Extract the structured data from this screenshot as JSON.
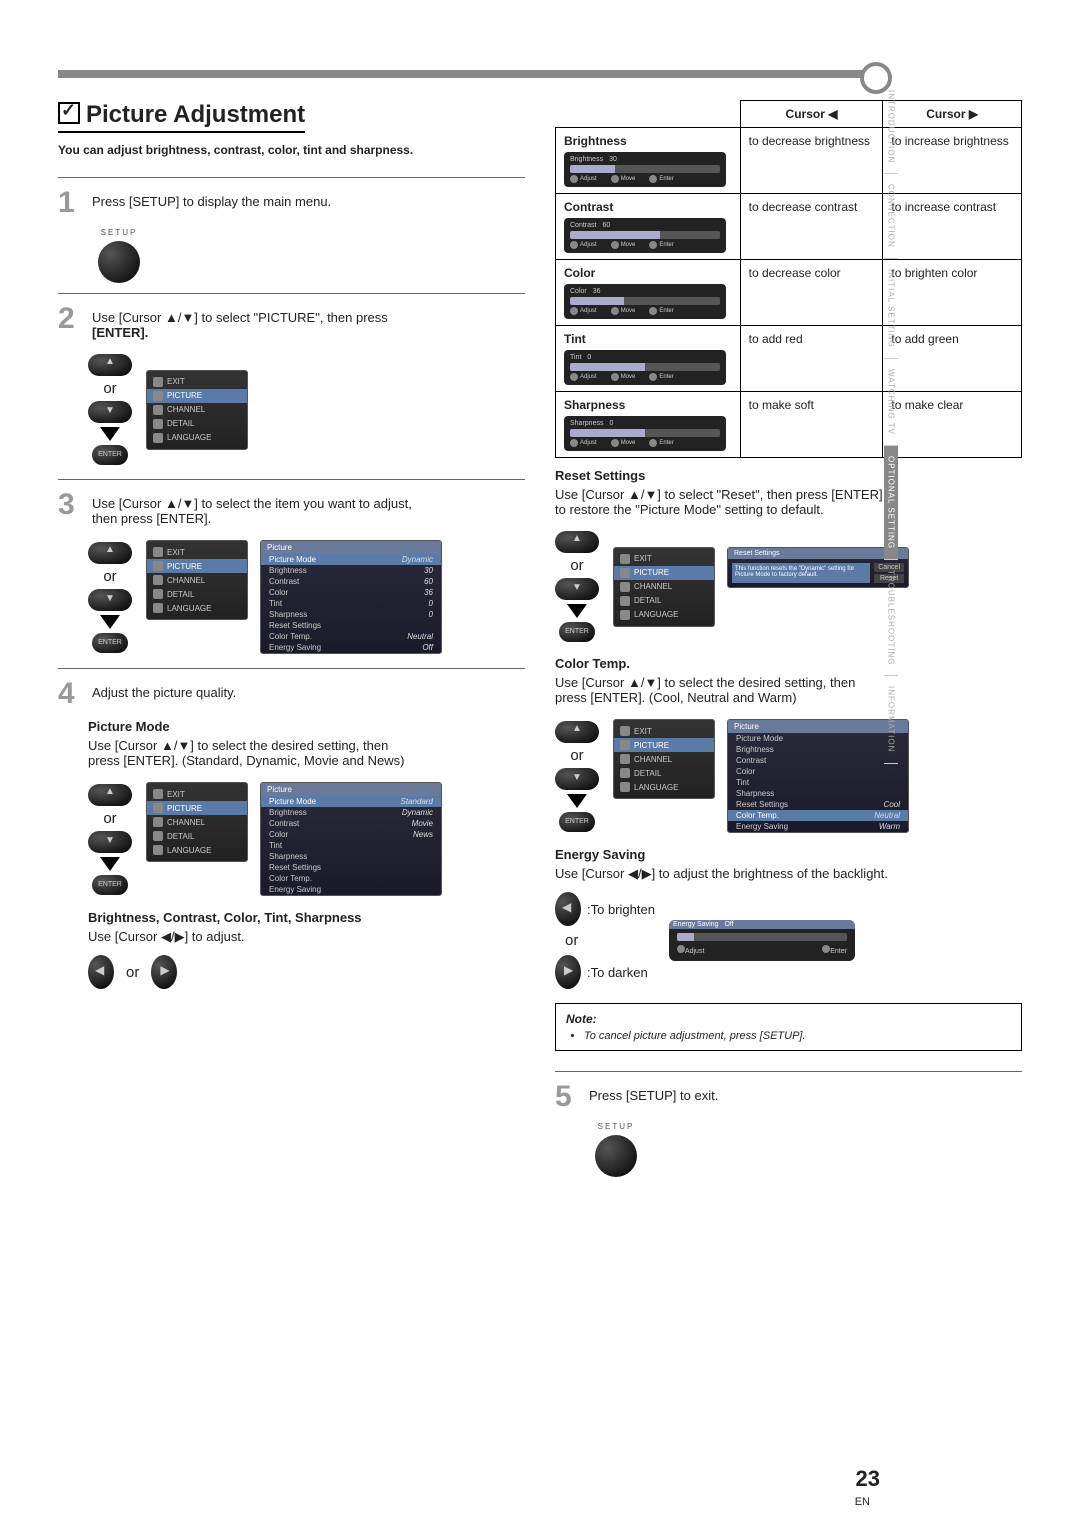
{
  "page_number": "23",
  "page_lang": "EN",
  "title": "Picture Adjustment",
  "intro": "You can adjust brightness, contrast, color, tint and sharpness.",
  "side_tabs": [
    "INTRODUCTION",
    "CONNECTION",
    "INITIAL SETTING",
    "WATCHING TV",
    "OPTIONAL SETTING",
    "TROUBLESHOOTING",
    "INFORMATION"
  ],
  "active_tab_index": 4,
  "steps": {
    "s1": "Press [SETUP] to display the main menu.",
    "s2_a": "Use [Cursor ▲/▼] to select \"PICTURE\", then press",
    "s2_b": "[ENTER].",
    "s3_a": "Use [Cursor ▲/▼] to select the item you want to adjust,",
    "s3_b": "then press [ENTER].",
    "s4": "Adjust the picture quality.",
    "s5": "Press [SETUP] to exit."
  },
  "labels": {
    "setup": "SETUP",
    "enter": "ENTER",
    "or": "or",
    "picture_mode_h": "Picture Mode",
    "pm_text_a": "Use [Cursor ▲/▼] to select the desired setting, then",
    "pm_text_b": "press [ENTER]. (Standard, Dynamic, Movie and News)",
    "bcct_h": "Brightness, Contrast, Color, Tint, Sharpness",
    "bcct_text": "Use [Cursor ◀/▶] to adjust.",
    "reset_h": "Reset Settings",
    "reset_text_a": "Use [Cursor ▲/▼] to select \"Reset\", then press [ENTER]",
    "reset_text_b": "to restore the \"Picture Mode\" setting to default.",
    "reset_msg": "This function resets the \"Dynamic\" setting for Picture Mode to factory default.",
    "reset_cancel": "Cancel",
    "reset_reset": "Reset",
    "colortemp_h": "Color Temp.",
    "colortemp_text_a": "Use [Cursor ▲/▼] to select the desired setting, then",
    "colortemp_text_b": "press [ENTER]. (Cool, Neutral and Warm)",
    "energy_h": "Energy Saving",
    "energy_text": "Use [Cursor ◀/▶] to adjust the brightness of the backlight.",
    "to_brighten": ":To brighten",
    "to_darken": ":To darken",
    "note_h": "Note:",
    "note_item": "To cancel picture adjustment, press [SETUP].",
    "adjust": "Adjust",
    "move": "Move",
    "enter_lc": "Enter"
  },
  "menu": {
    "items": [
      "EXIT",
      "PICTURE",
      "CHANNEL",
      "DETAIL",
      "LANGUAGE"
    ],
    "selected": 1
  },
  "picture_panel_head": "Picture",
  "picture_panel_rows_dynamic": [
    {
      "k": "Picture Mode",
      "v": "Dynamic",
      "hl": true
    },
    {
      "k": "Brightness",
      "v": "30"
    },
    {
      "k": "Contrast",
      "v": "60"
    },
    {
      "k": "Color",
      "v": "36"
    },
    {
      "k": "Tint",
      "v": "0"
    },
    {
      "k": "Sharpness",
      "v": "0"
    },
    {
      "k": "Reset Settings",
      "v": ""
    },
    {
      "k": "Color Temp.",
      "v": "Neutral"
    },
    {
      "k": "Energy Saving",
      "v": "Off"
    }
  ],
  "picture_panel_rows_modes": [
    {
      "k": "Picture Mode",
      "v": "Standard",
      "hl": true
    },
    {
      "k": "Brightness",
      "v": "Dynamic"
    },
    {
      "k": "Contrast",
      "v": "Movie"
    },
    {
      "k": "Color",
      "v": "News"
    },
    {
      "k": "Tint",
      "v": ""
    },
    {
      "k": "Sharpness",
      "v": ""
    },
    {
      "k": "Reset Settings",
      "v": ""
    },
    {
      "k": "Color Temp.",
      "v": ""
    },
    {
      "k": "Energy Saving",
      "v": ""
    }
  ],
  "picture_panel_rows_temp": [
    {
      "k": "Picture Mode",
      "v": ""
    },
    {
      "k": "Brightness",
      "v": ""
    },
    {
      "k": "Contrast",
      "v": ""
    },
    {
      "k": "Color",
      "v": ""
    },
    {
      "k": "Tint",
      "v": ""
    },
    {
      "k": "Sharpness",
      "v": ""
    },
    {
      "k": "Reset Settings",
      "v": "Cool"
    },
    {
      "k": "Color Temp.",
      "v": "Neutral",
      "hl": true
    },
    {
      "k": "Energy Saving",
      "v": "Warm"
    }
  ],
  "adjust_table": {
    "head_left": "Cursor ◀",
    "head_right": "Cursor ▶",
    "rows": [
      {
        "name": "Brightness",
        "val": "30",
        "fill": 30,
        "left": "to decrease brightness",
        "right": "to increase brightness"
      },
      {
        "name": "Contrast",
        "val": "60",
        "fill": 60,
        "left": "to decrease contrast",
        "right": "to increase contrast"
      },
      {
        "name": "Color",
        "val": "36",
        "fill": 36,
        "left": "to decrease color",
        "right": "to brighten color"
      },
      {
        "name": "Tint",
        "val": "0",
        "fill": 50,
        "left": "to add red",
        "right": "to add green"
      },
      {
        "name": "Sharpness",
        "val": "0",
        "fill": 50,
        "left": "to make soft",
        "right": "to make clear"
      }
    ]
  },
  "energy_slider": {
    "label": "Energy Saving",
    "value": "Off"
  },
  "reset_panel_head": "Reset Settings"
}
